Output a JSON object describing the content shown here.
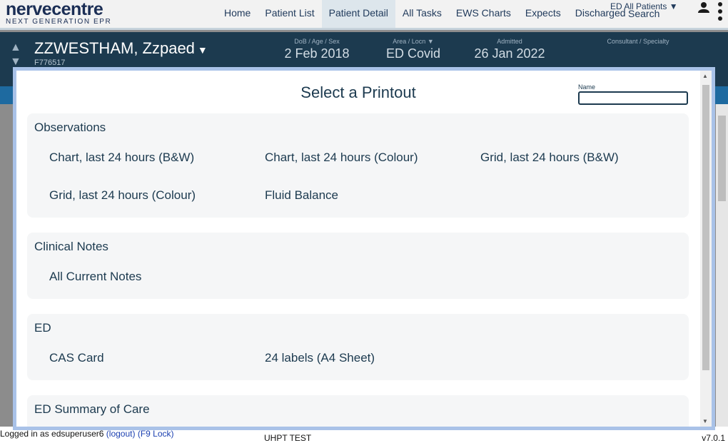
{
  "app": {
    "logo_main": "nervecentre",
    "logo_sub": "NEXT GENERATION EPR"
  },
  "nav": {
    "items": [
      "Home",
      "Patient List",
      "Patient Detail",
      "All Tasks",
      "EWS Charts",
      "Expects",
      "Discharged"
    ],
    "active": "Patient Detail",
    "ward_select": "ED All Patients",
    "search_label": "Search"
  },
  "patient": {
    "name": "ZZWESTHAM, Zzpaed",
    "id": "F776517",
    "dob_label": "DoB / Age / Sex",
    "dob_value": "2 Feb 2018",
    "area_label": "Area / Locn",
    "area_value": "ED Covid",
    "admitted_label": "Admitted",
    "admitted_value": "26 Jan 2022",
    "consultant_label": "Consultant / Specialty"
  },
  "modal": {
    "title": "Select a Printout",
    "name_label": "Name",
    "name_value": "",
    "sections": [
      {
        "title": "Observations",
        "options": [
          "Chart, last 24 hours (B&W)",
          "Chart, last 24 hours (Colour)",
          "Grid, last 24 hours (B&W)",
          "Grid, last 24 hours (Colour)",
          "Fluid Balance"
        ]
      },
      {
        "title": "Clinical Notes",
        "options": [
          "All Current Notes"
        ]
      },
      {
        "title": "ED",
        "options": [
          "CAS Card",
          "24 labels (A4 Sheet)"
        ]
      },
      {
        "title": "ED Summary of Care",
        "options": []
      }
    ]
  },
  "footer": {
    "logged_in_prefix": "Logged in as edsuperuser6",
    "logout": "(logout)",
    "lock": "(F9 Lock)",
    "environment": "UHPT TEST",
    "version": "v7.0.1"
  },
  "colors": {
    "banner": "#1c3a4f",
    "modal_border": "#a9c2e8",
    "text": "#1c3a4f"
  }
}
